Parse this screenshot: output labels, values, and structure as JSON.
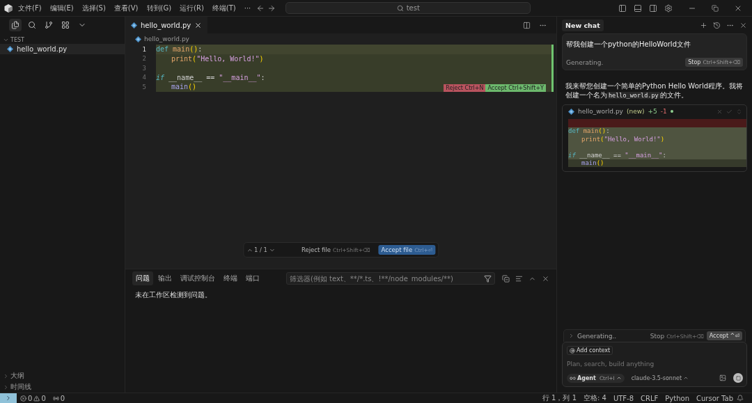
{
  "title_bar": {
    "menu": [
      "文件(F)",
      "编辑(E)",
      "选择(S)",
      "查看(V)",
      "转到(G)",
      "运行(R)",
      "终端(T)",
      "···"
    ],
    "search": "test"
  },
  "explorer": {
    "section": "TEST",
    "files": [
      {
        "name": "hello_world.py",
        "selected": true
      }
    ],
    "bottom_sections": [
      "大纲",
      "时间线"
    ]
  },
  "editor": {
    "tabs": [
      {
        "label": "hello_world.py",
        "selected": true
      }
    ],
    "breadcrumb": "hello_world.py",
    "lines": [
      {
        "number": "1",
        "current": true,
        "indent": false,
        "tokens": [
          {
            "kind": "keyword",
            "text": "def"
          },
          {
            "kind": "function",
            "text": "main"
          },
          {
            "kind": "paren",
            "text": "()"
          },
          {
            "kind": "plain",
            "text": ":"
          }
        ]
      },
      {
        "number": "2",
        "current": false,
        "indent": true,
        "tokens": [
          {
            "kind": "function",
            "text": "print"
          },
          {
            "kind": "paren",
            "text": "("
          },
          {
            "kind": "string",
            "text": "\"Hello, World!\""
          },
          {
            "kind": "paren",
            "text": ")"
          }
        ]
      },
      {
        "number": "3",
        "current": false
      },
      {
        "number": "4",
        "current": false,
        "indent": false,
        "tokens": [
          {
            "kind": "control",
            "text": "if"
          },
          {
            "kind": "plain",
            "text": "__name__ == "
          },
          {
            "kind": "string",
            "text": "\"__main__\""
          },
          {
            "kind": "plain",
            "text": ":"
          }
        ]
      },
      {
        "number": "5",
        "current": false,
        "indent": true,
        "tokens": [
          {
            "kind": "call",
            "text": "main"
          },
          {
            "kind": "paren",
            "text": "()"
          }
        ]
      }
    ],
    "inline_actions": [
      {
        "kind": "reject",
        "label": "Reject",
        "shortcut": "Ctrl+N"
      },
      {
        "kind": "accept",
        "label": "Accept",
        "shortcut": "Ctrl+Shift+Y"
      }
    ],
    "review_bar": {
      "counter": "1 / 1",
      "actions": [
        {
          "kind": "reject",
          "label": "Reject file",
          "shortcut": "Ctrl+Shift+⌫"
        },
        {
          "kind": "accept",
          "label": "Accept file",
          "shortcut": "Ctrl+⏎"
        }
      ]
    }
  },
  "panel": {
    "tabs": [
      {
        "label": "问题",
        "selected": true
      },
      {
        "label": "输出",
        "selected": false
      },
      {
        "label": "调试控制台",
        "selected": false
      },
      {
        "label": "终端",
        "selected": false
      },
      {
        "label": "端口",
        "selected": false
      }
    ],
    "filter": {
      "placeholder": "筛选器(例如 text、**/*.ts、!**/node_modules/**)"
    },
    "message": "未在工作区检测到问题。"
  },
  "chat": {
    "title": "New chat",
    "user_message": "帮我创建一个python的HelloWorld文件",
    "status": "Generating.",
    "stop": {
      "label": "Stop",
      "shortcut": "Ctrl+Shift+⌫"
    },
    "reply": [
      {
        "kind": "text",
        "text": "我来帮您创建一个简单的Python Hello World程序。我将创建一个名为"
      },
      {
        "kind": "code",
        "text": "hello_world.py"
      },
      {
        "kind": "text",
        "text": "的文件。"
      }
    ],
    "diff_card": {
      "file": "hello_world.py",
      "badge": "(new)",
      "added": "+5",
      "removed": "-1",
      "lines": [
        {
          "kind": "removed"
        },
        {
          "kind": "added",
          "indent": false,
          "tokens": [
            {
              "kind": "keyword",
              "text": "def"
            },
            {
              "kind": "function",
              "text": "main"
            },
            {
              "kind": "paren",
              "text": "()"
            },
            {
              "kind": "plain",
              "text": ":"
            }
          ]
        },
        {
          "kind": "added",
          "indent": true,
          "tokens": [
            {
              "kind": "function",
              "text": "print"
            },
            {
              "kind": "paren",
              "text": "("
            },
            {
              "kind": "string",
              "text": "\"Hello, World!\""
            },
            {
              "kind": "paren",
              "text": ")"
            }
          ]
        },
        {
          "kind": "added"
        },
        {
          "kind": "added",
          "indent": false,
          "tokens": [
            {
              "kind": "control",
              "text": "if"
            },
            {
              "kind": "plain",
              "text": "__name__ == "
            },
            {
              "kind": "string",
              "text": "\"__main__\""
            },
            {
              "kind": "plain",
              "text": ":"
            }
          ]
        },
        {
          "kind": "streaming",
          "indent": true,
          "tokens": [
            {
              "kind": "call",
              "text": "main"
            },
            {
              "kind": "paren",
              "text": "()"
            }
          ]
        }
      ]
    },
    "generating_bar": {
      "label": "Generating..",
      "stop": "Stop",
      "stop_shortcut": "Ctrl+Shift+⌫",
      "accept": "Accept",
      "accept_shortcut": "^⏎"
    },
    "composer": {
      "context_button": "Add context",
      "placeholder": "Plan, search, build anything",
      "mode": "Agent",
      "mode_shortcut": "Ctrl+I",
      "model": "claude-3.5-sonnet"
    }
  },
  "status_bar": {
    "errors": "0",
    "warnings": "0",
    "ports": "0",
    "items": [
      "行 1，列 1",
      "空格: 4",
      "UTF-8",
      "CRLF",
      "Python",
      "Cursor Tab"
    ]
  }
}
